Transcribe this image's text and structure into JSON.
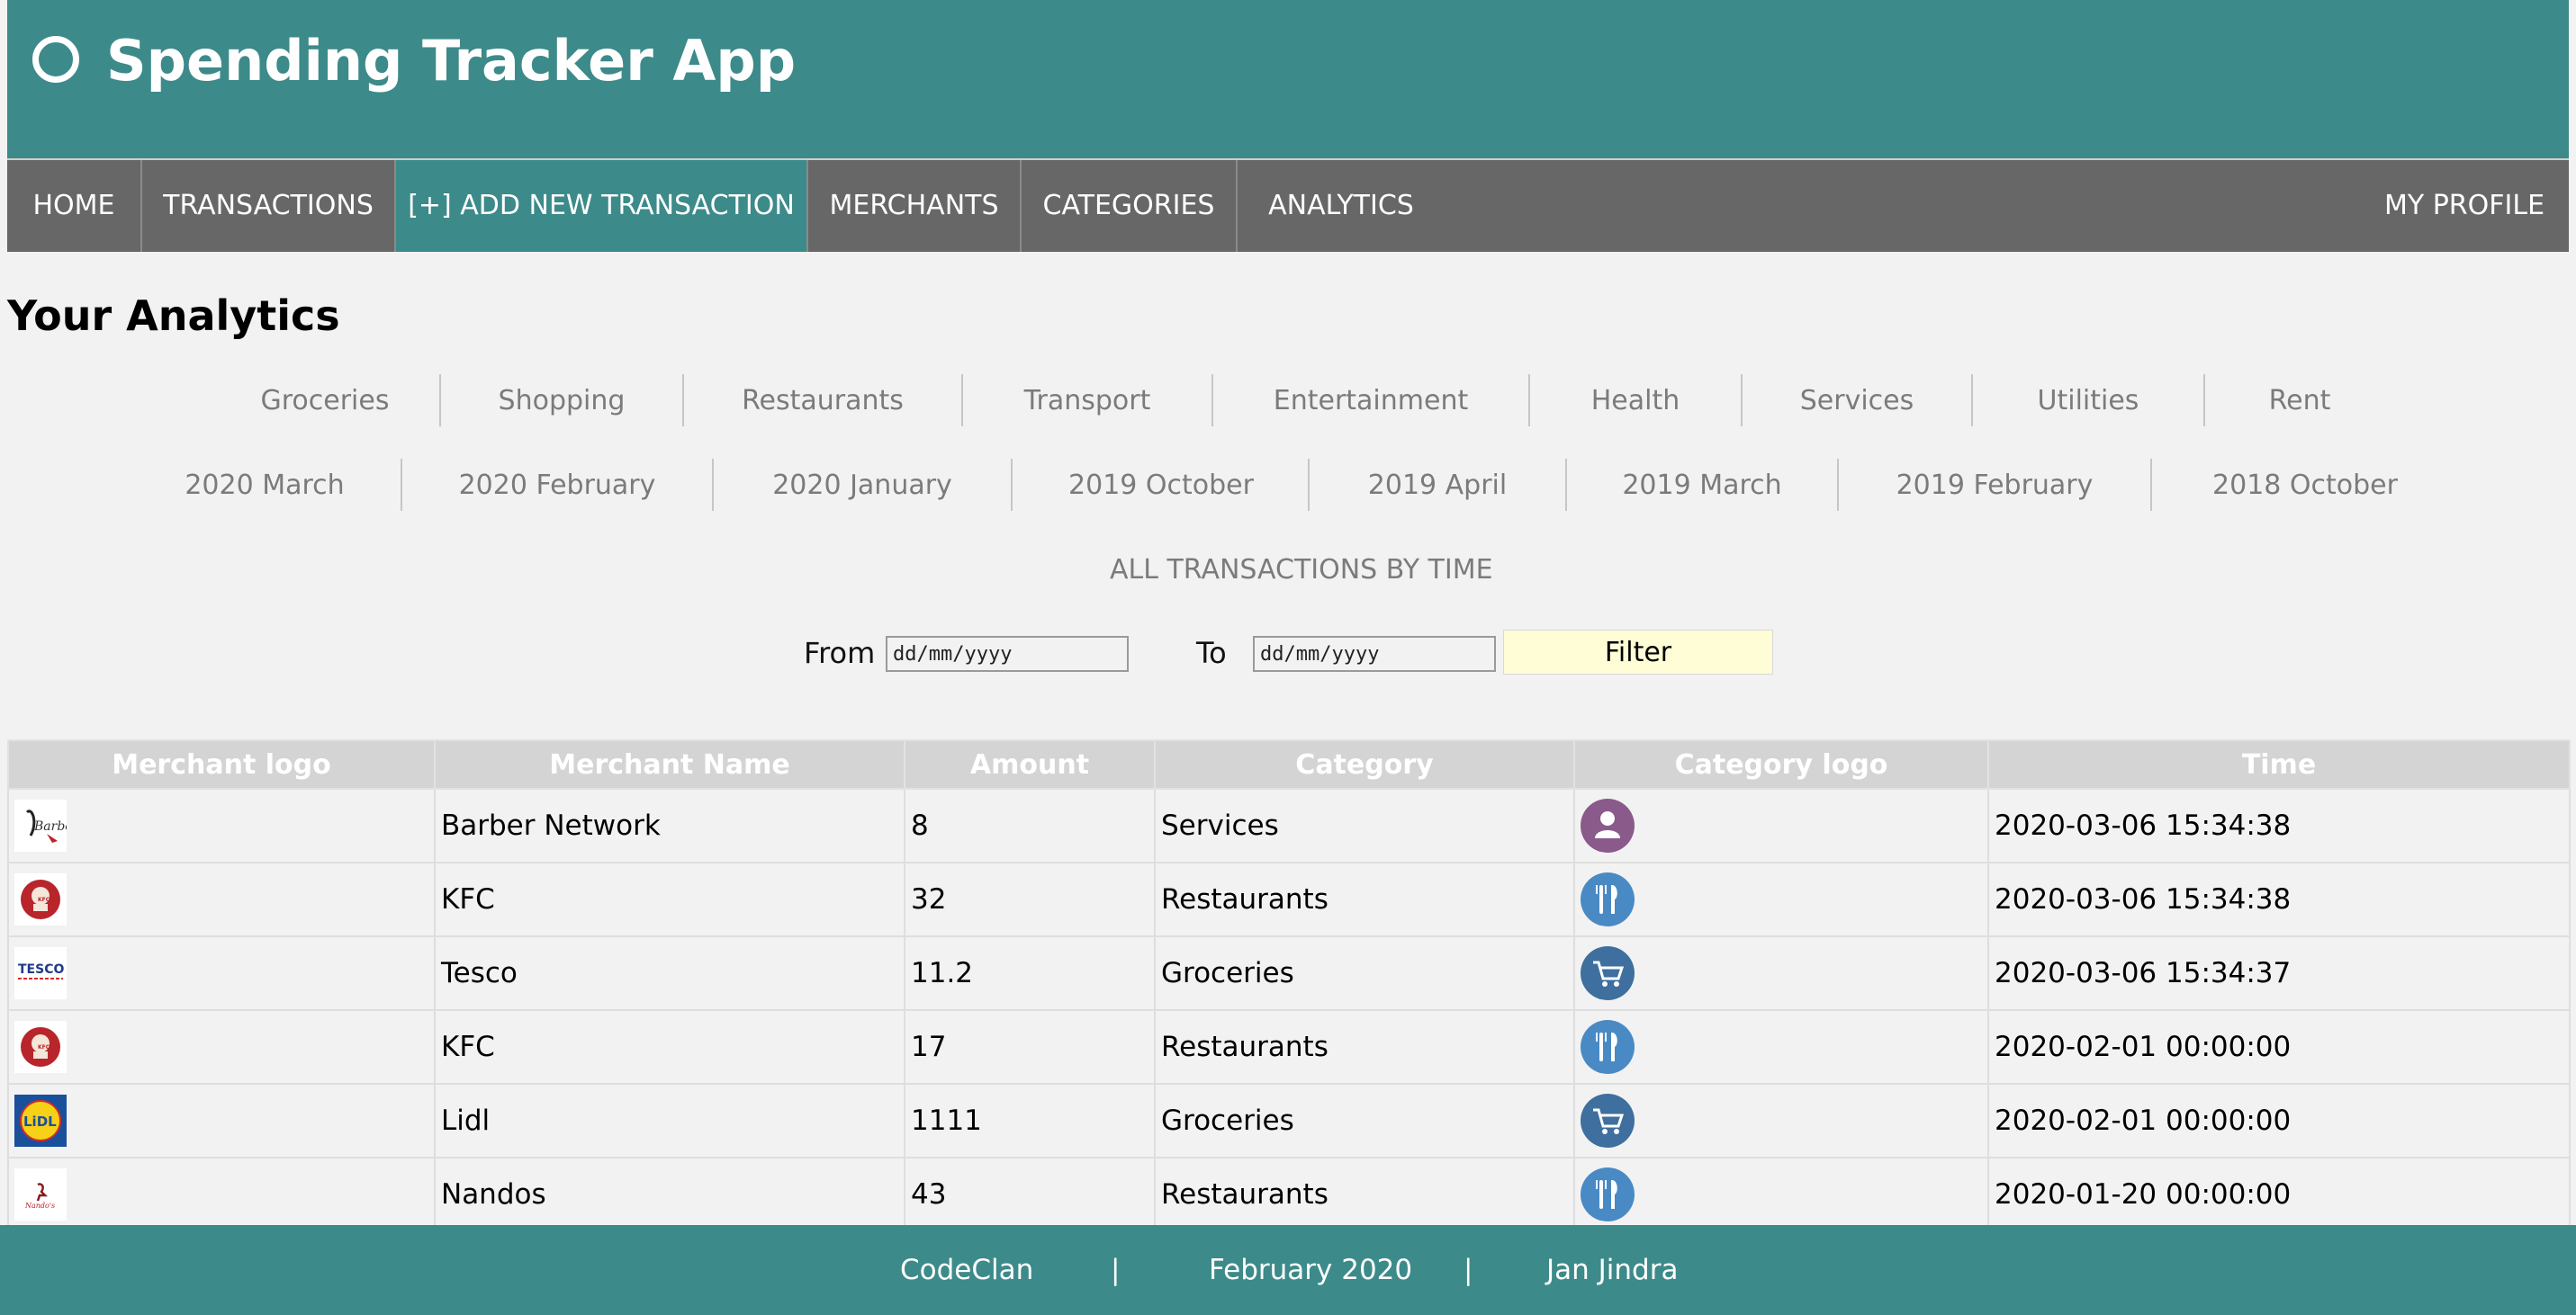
{
  "app": {
    "title": "Spending Tracker App"
  },
  "nav": {
    "home": "HOME",
    "transactions": "TRANSACTIONS",
    "add_new": "[+] ADD NEW TRANSACTION",
    "merchants": "MERCHANTS",
    "categories": "CATEGORIES",
    "analytics": "ANALYTICS",
    "profile": "MY PROFILE",
    "active": "ADD NEW TRANSACTION"
  },
  "page": {
    "title": "Your Analytics"
  },
  "category_filters": [
    "Groceries",
    "Shopping",
    "Restaurants",
    "Transport",
    "Entertainment",
    "Health",
    "Services",
    "Utilities",
    "Rent"
  ],
  "month_filters": [
    "2020 March",
    "2020 February",
    "2020 January",
    "2019 October",
    "2019 April",
    "2019 March",
    "2019 February",
    "2018 October"
  ],
  "all_transactions_link": "ALL TRANSACTIONS BY TIME",
  "date_filter": {
    "from_label": "From",
    "to_label": "To",
    "from_placeholder": "dd/mm/yyyy",
    "to_placeholder": "dd/mm/yyyy",
    "button": "Filter"
  },
  "table": {
    "headers": [
      "Merchant logo",
      "Merchant Name",
      "Amount",
      "Category",
      "Category logo",
      "Time"
    ],
    "rows": [
      {
        "merchant": "Barber Network",
        "amount": "8",
        "category": "Services",
        "time": "2020-03-06 15:34:38",
        "logo": "barber-network-logo",
        "category_icon": "person-icon",
        "icon_color": "#8a5a8a"
      },
      {
        "merchant": "KFC",
        "amount": "32",
        "category": "Restaurants",
        "time": "2020-03-06 15:34:38",
        "logo": "kfc-logo",
        "category_icon": "cutlery-icon",
        "icon_color": "#4a8ac4"
      },
      {
        "merchant": "Tesco",
        "amount": "11.2",
        "category": "Groceries",
        "time": "2020-03-06 15:34:37",
        "logo": "tesco-logo",
        "category_icon": "shopping-cart-icon",
        "icon_color": "#3e6f9e"
      },
      {
        "merchant": "KFC",
        "amount": "17",
        "category": "Restaurants",
        "time": "2020-02-01 00:00:00",
        "logo": "kfc-logo",
        "category_icon": "cutlery-icon",
        "icon_color": "#4a8ac4"
      },
      {
        "merchant": "Lidl",
        "amount": "1111",
        "category": "Groceries",
        "time": "2020-02-01 00:00:00",
        "logo": "lidl-logo",
        "category_icon": "shopping-cart-icon",
        "icon_color": "#3e6f9e"
      },
      {
        "merchant": "Nandos",
        "amount": "43",
        "category": "Restaurants",
        "time": "2020-01-20 00:00:00",
        "logo": "nandos-logo",
        "category_icon": "cutlery-icon",
        "icon_color": "#4a8ac4"
      }
    ]
  },
  "footer": {
    "org": "CodeClan",
    "separator": "|",
    "date": "February 2020",
    "author": "Jan Jindra"
  },
  "colors": {
    "primary": "#3d8a8a",
    "nav_background": "#676767",
    "filter_button": "#fffdd6",
    "page_background": "#f2f2f2"
  }
}
